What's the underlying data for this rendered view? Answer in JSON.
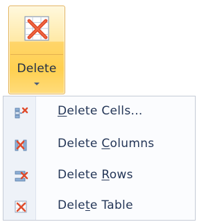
{
  "ribbon": {
    "delete_button": {
      "label": "Delete",
      "icon": "delete-table-large-icon"
    }
  },
  "menu": {
    "items": [
      {
        "pre": "",
        "key": "D",
        "post": "elete Cells...",
        "icon": "delete-cells-icon"
      },
      {
        "pre": "Delete ",
        "key": "C",
        "post": "olumns",
        "icon": "delete-columns-icon"
      },
      {
        "pre": "Delete ",
        "key": "R",
        "post": "ows",
        "icon": "delete-rows-icon"
      },
      {
        "pre": "Dele",
        "key": "t",
        "post": "e Table",
        "icon": "delete-table-icon"
      }
    ]
  },
  "colors": {
    "highlight": "#ffd050",
    "menu_text": "#243657",
    "red_x": "#e04a2a"
  }
}
